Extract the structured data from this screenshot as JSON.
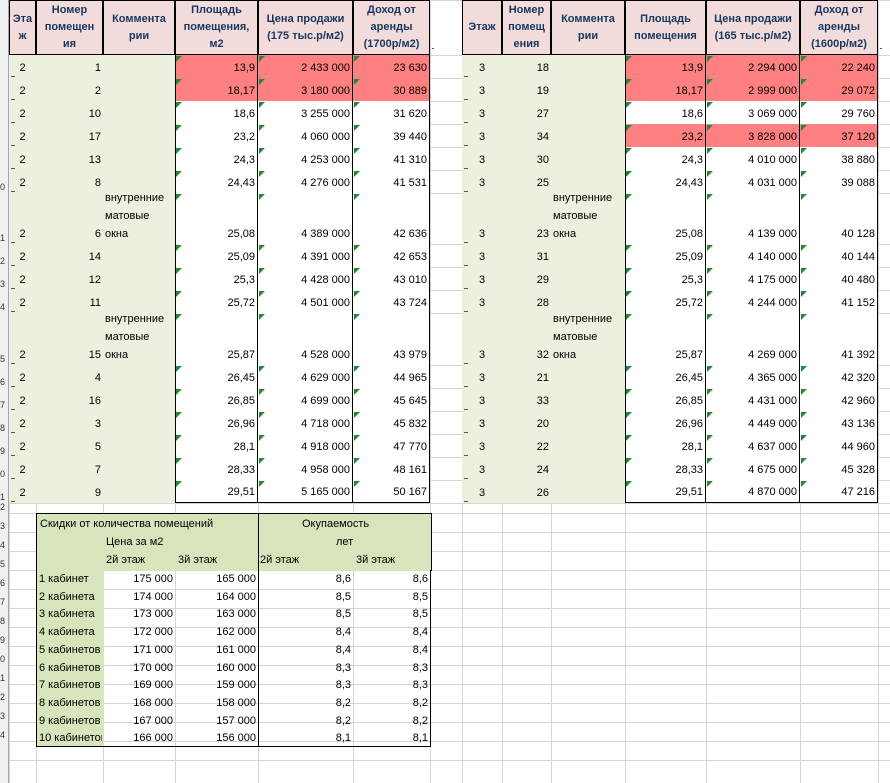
{
  "table_left": {
    "headers": [
      "Эта\nж",
      "Номер\nпомещен\nия",
      "Коммента\nрии",
      "Площадь\nпомещения,\nм2",
      "Цена продажи\n(175 тыс.р/м2)",
      "Доход от\nаренды\n(1700р/м2)"
    ],
    "rows": [
      {
        "floor": "2",
        "num": "1",
        "comment": "",
        "area": "13,9",
        "price": "2 433 000",
        "rent": "23 630",
        "hl": true
      },
      {
        "floor": "2",
        "num": "2",
        "comment": "",
        "area": "18,17",
        "price": "3 180 000",
        "rent": "30 889",
        "hl": true
      },
      {
        "floor": "2",
        "num": "10",
        "comment": "",
        "area": "18,6",
        "price": "3 255 000",
        "rent": "31 620",
        "hl": false
      },
      {
        "floor": "2",
        "num": "17",
        "comment": "",
        "area": "23,2",
        "price": "4 060 000",
        "rent": "39 440",
        "hl": false
      },
      {
        "floor": "2",
        "num": "13",
        "comment": "",
        "area": "24,3",
        "price": "4 253 000",
        "rent": "41 310",
        "hl": false
      },
      {
        "floor": "2",
        "num": "8",
        "comment": "",
        "area": "24,43",
        "price": "4 276 000",
        "rent": "41 531",
        "hl": false
      },
      {
        "floor": "2",
        "num": "6",
        "comment": "внутренние\nматовые\nокна",
        "area": "25,08",
        "price": "4 389 000",
        "rent": "42 636",
        "hl": false
      },
      {
        "floor": "2",
        "num": "14",
        "comment": "",
        "area": "25,09",
        "price": "4 391 000",
        "rent": "42 653",
        "hl": false
      },
      {
        "floor": "2",
        "num": "12",
        "comment": "",
        "area": "25,3",
        "price": "4 428 000",
        "rent": "43 010",
        "hl": false
      },
      {
        "floor": "2",
        "num": "11",
        "comment": "",
        "area": "25,72",
        "price": "4 501 000",
        "rent": "43 724",
        "hl": false
      },
      {
        "floor": "2",
        "num": "15",
        "comment": "внутренние\nматовые\nокна",
        "area": "25,87",
        "price": "4 528 000",
        "rent": "43 979",
        "hl": false
      },
      {
        "floor": "2",
        "num": "4",
        "comment": "",
        "area": "26,45",
        "price": "4 629 000",
        "rent": "44 965",
        "hl": false
      },
      {
        "floor": "2",
        "num": "16",
        "comment": "",
        "area": "26,85",
        "price": "4 699 000",
        "rent": "45 645",
        "hl": false
      },
      {
        "floor": "2",
        "num": "3",
        "comment": "",
        "area": "26,96",
        "price": "4 718 000",
        "rent": "45 832",
        "hl": false
      },
      {
        "floor": "2",
        "num": "5",
        "comment": "",
        "area": "28,1",
        "price": "4 918 000",
        "rent": "47 770",
        "hl": false
      },
      {
        "floor": "2",
        "num": "7",
        "comment": "",
        "area": "28,33",
        "price": "4 958 000",
        "rent": "48 161",
        "hl": false
      },
      {
        "floor": "2",
        "num": "9",
        "comment": "",
        "area": "29,51",
        "price": "5 165 000",
        "rent": "50 167",
        "hl": false
      }
    ]
  },
  "table_right": {
    "headers": [
      "Этаж",
      "Номер\nпомещ\nения",
      "Коммента\nрии",
      "Площадь\nпомещения",
      "Цена продажи\n(165 тыс.р/м2)",
      "Доход от\nаренды\n(1600р/м2)"
    ],
    "rows": [
      {
        "floor": "3",
        "num": "18",
        "comment": "",
        "area": "13,9",
        "price": "2 294 000",
        "rent": "22 240",
        "hl": true
      },
      {
        "floor": "3",
        "num": "19",
        "comment": "",
        "area": "18,17",
        "price": "2 999 000",
        "rent": "29 072",
        "hl": true
      },
      {
        "floor": "3",
        "num": "27",
        "comment": "",
        "area": "18,6",
        "price": "3 069 000",
        "rent": "29 760",
        "hl": false
      },
      {
        "floor": "3",
        "num": "34",
        "comment": "",
        "area": "23,2",
        "price": "3 828 000",
        "rent": "37 120",
        "hl": true
      },
      {
        "floor": "3",
        "num": "30",
        "comment": "",
        "area": "24,3",
        "price": "4 010 000",
        "rent": "38 880",
        "hl": false
      },
      {
        "floor": "3",
        "num": "25",
        "comment": "",
        "area": "24,43",
        "price": "4 031 000",
        "rent": "39 088",
        "hl": false
      },
      {
        "floor": "3",
        "num": "23",
        "comment": "внутренние\nматовые\nокна",
        "area": "25,08",
        "price": "4 139 000",
        "rent": "40 128",
        "hl": false
      },
      {
        "floor": "3",
        "num": "31",
        "comment": "",
        "area": "25,09",
        "price": "4 140 000",
        "rent": "40 144",
        "hl": false
      },
      {
        "floor": "3",
        "num": "29",
        "comment": "",
        "area": "25,3",
        "price": "4 175 000",
        "rent": "40 480",
        "hl": false
      },
      {
        "floor": "3",
        "num": "28",
        "comment": "",
        "area": "25,72",
        "price": "4 244 000",
        "rent": "41 152",
        "hl": false
      },
      {
        "floor": "3",
        "num": "32",
        "comment": "внутренние\nматовые\nокна",
        "area": "25,87",
        "price": "4 269 000",
        "rent": "41 392",
        "hl": false
      },
      {
        "floor": "3",
        "num": "21",
        "comment": "",
        "area": "26,45",
        "price": "4 365 000",
        "rent": "42 320",
        "hl": false
      },
      {
        "floor": "3",
        "num": "33",
        "comment": "",
        "area": "26,85",
        "price": "4 431 000",
        "rent": "42 960",
        "hl": false
      },
      {
        "floor": "3",
        "num": "20",
        "comment": "",
        "area": "26,96",
        "price": "4 449 000",
        "rent": "43 136",
        "hl": false
      },
      {
        "floor": "3",
        "num": "22",
        "comment": "",
        "area": "28,1",
        "price": "4 637 000",
        "rent": "44 960",
        "hl": false
      },
      {
        "floor": "3",
        "num": "24",
        "comment": "",
        "area": "28,33",
        "price": "4 675 000",
        "rent": "45 328",
        "hl": false
      },
      {
        "floor": "3",
        "num": "26",
        "comment": "",
        "area": "29,51",
        "price": "4 870 000",
        "rent": "47 216",
        "hl": false
      }
    ]
  },
  "discount": {
    "title": "Скидки от количества помещений",
    "price_label": "Цена за м2",
    "payback_label": "Окупаемость",
    "years_label": "лет",
    "floor2": "2й этаж",
    "floor3": "3й этаж",
    "floor2b": "2й этаж",
    "floor3b": "3й этаж",
    "rows": [
      {
        "label": "1 кабинет",
        "p2": "175 000",
        "p3": "165 000",
        "y2": "8,6",
        "y3": "8,6"
      },
      {
        "label": "2 кабинета",
        "p2": "174 000",
        "p3": "164 000",
        "y2": "8,5",
        "y3": "8,5"
      },
      {
        "label": "3 кабинета",
        "p2": "173 000",
        "p3": "163 000",
        "y2": "8,5",
        "y3": "8,5"
      },
      {
        "label": "4 кабинета",
        "p2": "172 000",
        "p3": "162 000",
        "y2": "8,4",
        "y3": "8,4"
      },
      {
        "label": "5 кабинетов",
        "p2": "171 000",
        "p3": "161 000",
        "y2": "8,4",
        "y3": "8,4"
      },
      {
        "label": "6 кабинетов",
        "p2": "170 000",
        "p3": "160 000",
        "y2": "8,3",
        "y3": "8,3"
      },
      {
        "label": "7 кабинетов",
        "p2": "169 000",
        "p3": "159 000",
        "y2": "8,3",
        "y3": "8,3"
      },
      {
        "label": "8 кабинетов",
        "p2": "168 000",
        "p3": "158 000",
        "y2": "8,2",
        "y3": "8,2"
      },
      {
        "label": "9 кабинетов",
        "p2": "167 000",
        "p3": "157 000",
        "y2": "8,2",
        "y3": "8,2"
      },
      {
        "label": "10 кабинетов",
        "p2": "166 000",
        "p3": "156 000",
        "y2": "8,1",
        "y3": "8,1"
      }
    ]
  },
  "row_numbers": [
    "",
    "",
    "",
    "",
    "",
    "",
    "0",
    "1",
    "2",
    "3",
    "4",
    "5",
    "6",
    "7",
    "8",
    "9",
    "0",
    "1",
    "2",
    "3",
    "4",
    "5",
    "6",
    "7",
    "8",
    "9",
    "0",
    "1",
    "2",
    "3",
    "4"
  ],
  "colors": {
    "header_bg": "#f2dcdb",
    "header_text": "#17375e",
    "green_bg": "#ebf1de",
    "red_bg": "#ff8080",
    "discount_bg": "#d8e4bc"
  }
}
